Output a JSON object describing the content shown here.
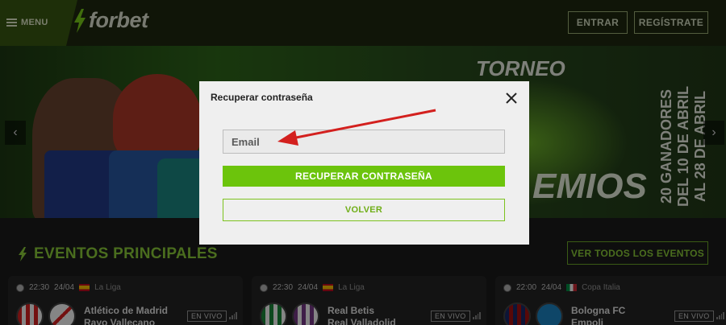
{
  "header": {
    "menu_label": "MENU",
    "logo_text": "forbet",
    "login_label": "ENTRAR",
    "register_label": "REGÍSTRATE"
  },
  "banner": {
    "title": "TORNEO",
    "subtitle": "EMIOS",
    "side_text": "20 GANADORES DEL 10 DE ABRIL AL 28 DE ABRIL"
  },
  "events": {
    "section_title": "EVENTOS PRINCIPALES",
    "view_all_label": "VER TODOS LOS EVENTOS",
    "cards": [
      {
        "time": "22:30",
        "date": "24/04",
        "league": "La Liga",
        "team1": "Atlético de Madrid",
        "team2": "Rayo Vallecano",
        "live_label": "EN VIVO"
      },
      {
        "time": "22:30",
        "date": "24/04",
        "league": "La Liga",
        "team1": "Real Betis",
        "team2": "Real Valladolid",
        "live_label": "EN VIVO"
      },
      {
        "time": "22:00",
        "date": "24/04",
        "league": "Copa Italia",
        "team1": "Bologna FC",
        "team2": "Empoli",
        "live_label": "EN VIVO"
      }
    ]
  },
  "modal": {
    "title": "Recuperar contraseña",
    "email_placeholder": "Email",
    "recover_label": "RECUPERAR CONTRASEÑA",
    "back_label": "VOLVER"
  },
  "colors": {
    "brand_green": "#6cc40c",
    "annotation_arrow": "#d3201e"
  }
}
